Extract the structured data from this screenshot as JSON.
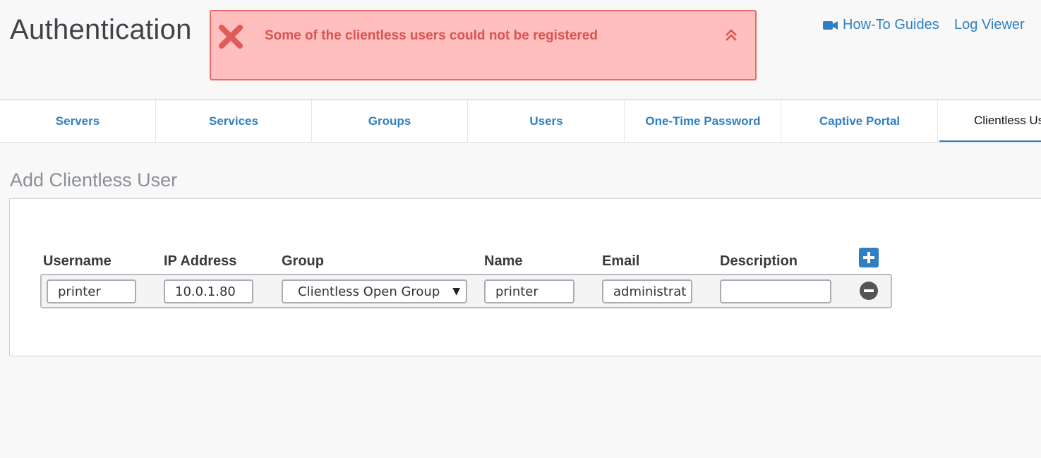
{
  "header": {
    "title": "Authentication",
    "links": {
      "guides": "How-To Guides",
      "log_viewer": "Log Viewer"
    }
  },
  "alert": {
    "message": "Some of the clientless users could not be registered",
    "color": "#ffbfbf",
    "border_color": "#e86a6a",
    "icon": "close-x-icon"
  },
  "tabs": [
    {
      "label": "Servers"
    },
    {
      "label": "Services"
    },
    {
      "label": "Groups"
    },
    {
      "label": "Users"
    },
    {
      "label": "One-Time Password"
    },
    {
      "label": "Captive Portal"
    },
    {
      "label": "Clientless Us",
      "active": true
    }
  ],
  "form": {
    "section_title": "Add Clientless User",
    "columns": {
      "username": "Username",
      "ip_address": "IP Address",
      "group": "Group",
      "name": "Name",
      "email": "Email",
      "description": "Description"
    },
    "row": {
      "username": "printer",
      "ip_address": "10.0.1.80",
      "group": "Clientless Open Group",
      "name": "printer",
      "email": "administrat",
      "description": ""
    }
  },
  "colors": {
    "accent": "#2f7fc1",
    "error_text": "#d9534f"
  }
}
